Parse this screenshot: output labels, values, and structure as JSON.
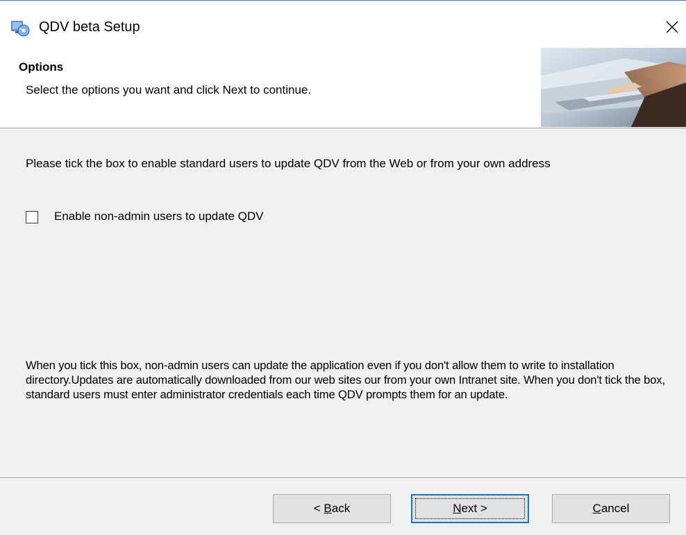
{
  "window": {
    "title": "QDV beta Setup"
  },
  "header": {
    "title": "Options",
    "description": "Select the options you want and click Next to continue."
  },
  "body": {
    "intro": "Please tick the box to enable standard users to update QDV from the Web or from your own address",
    "checkbox": {
      "label": "Enable non-admin users to update QDV",
      "checked": false
    },
    "note": "When you tick this box, non-admin users can update the application even if you don't allow them to write to installation directory.Updates are automatically downloaded from our web sites our from your own Intranet site. When you don't tick the box, standard users must enter administrator credentials each time QDV prompts them for an update."
  },
  "buttons": {
    "back": {
      "prefix": "< ",
      "mnemonic": "B",
      "rest": "ack"
    },
    "next": {
      "mnemonic": "N",
      "rest": "ext >"
    },
    "cancel": {
      "mnemonic": "C",
      "rest": "ancel"
    }
  },
  "icons": {
    "app": "installer-icon",
    "close": "close-icon"
  }
}
